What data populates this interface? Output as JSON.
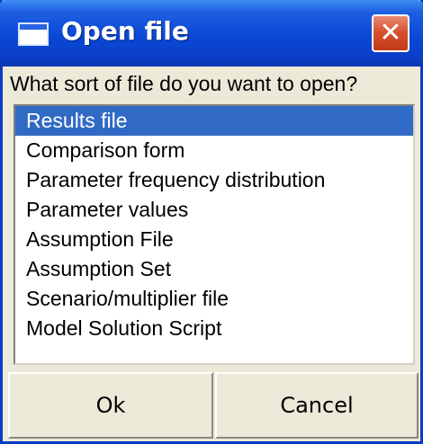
{
  "window": {
    "title": "Open file",
    "close_label": "✕"
  },
  "prompt": "What sort of file do you want to open?",
  "file_types": {
    "selected_index": 0,
    "items": [
      "Results file",
      "Comparison form",
      "Parameter frequency distribution",
      "Parameter values",
      "Assumption File",
      "Assumption Set",
      "Scenario/multiplier file",
      "Model Solution Script"
    ]
  },
  "buttons": {
    "ok_label": "Ok",
    "cancel_label": "Cancel"
  },
  "colors": {
    "titlebar": "#0a48d6",
    "selection": "#316ac5",
    "close_button": "#d7532f",
    "dialog_background": "#ece9d8"
  }
}
